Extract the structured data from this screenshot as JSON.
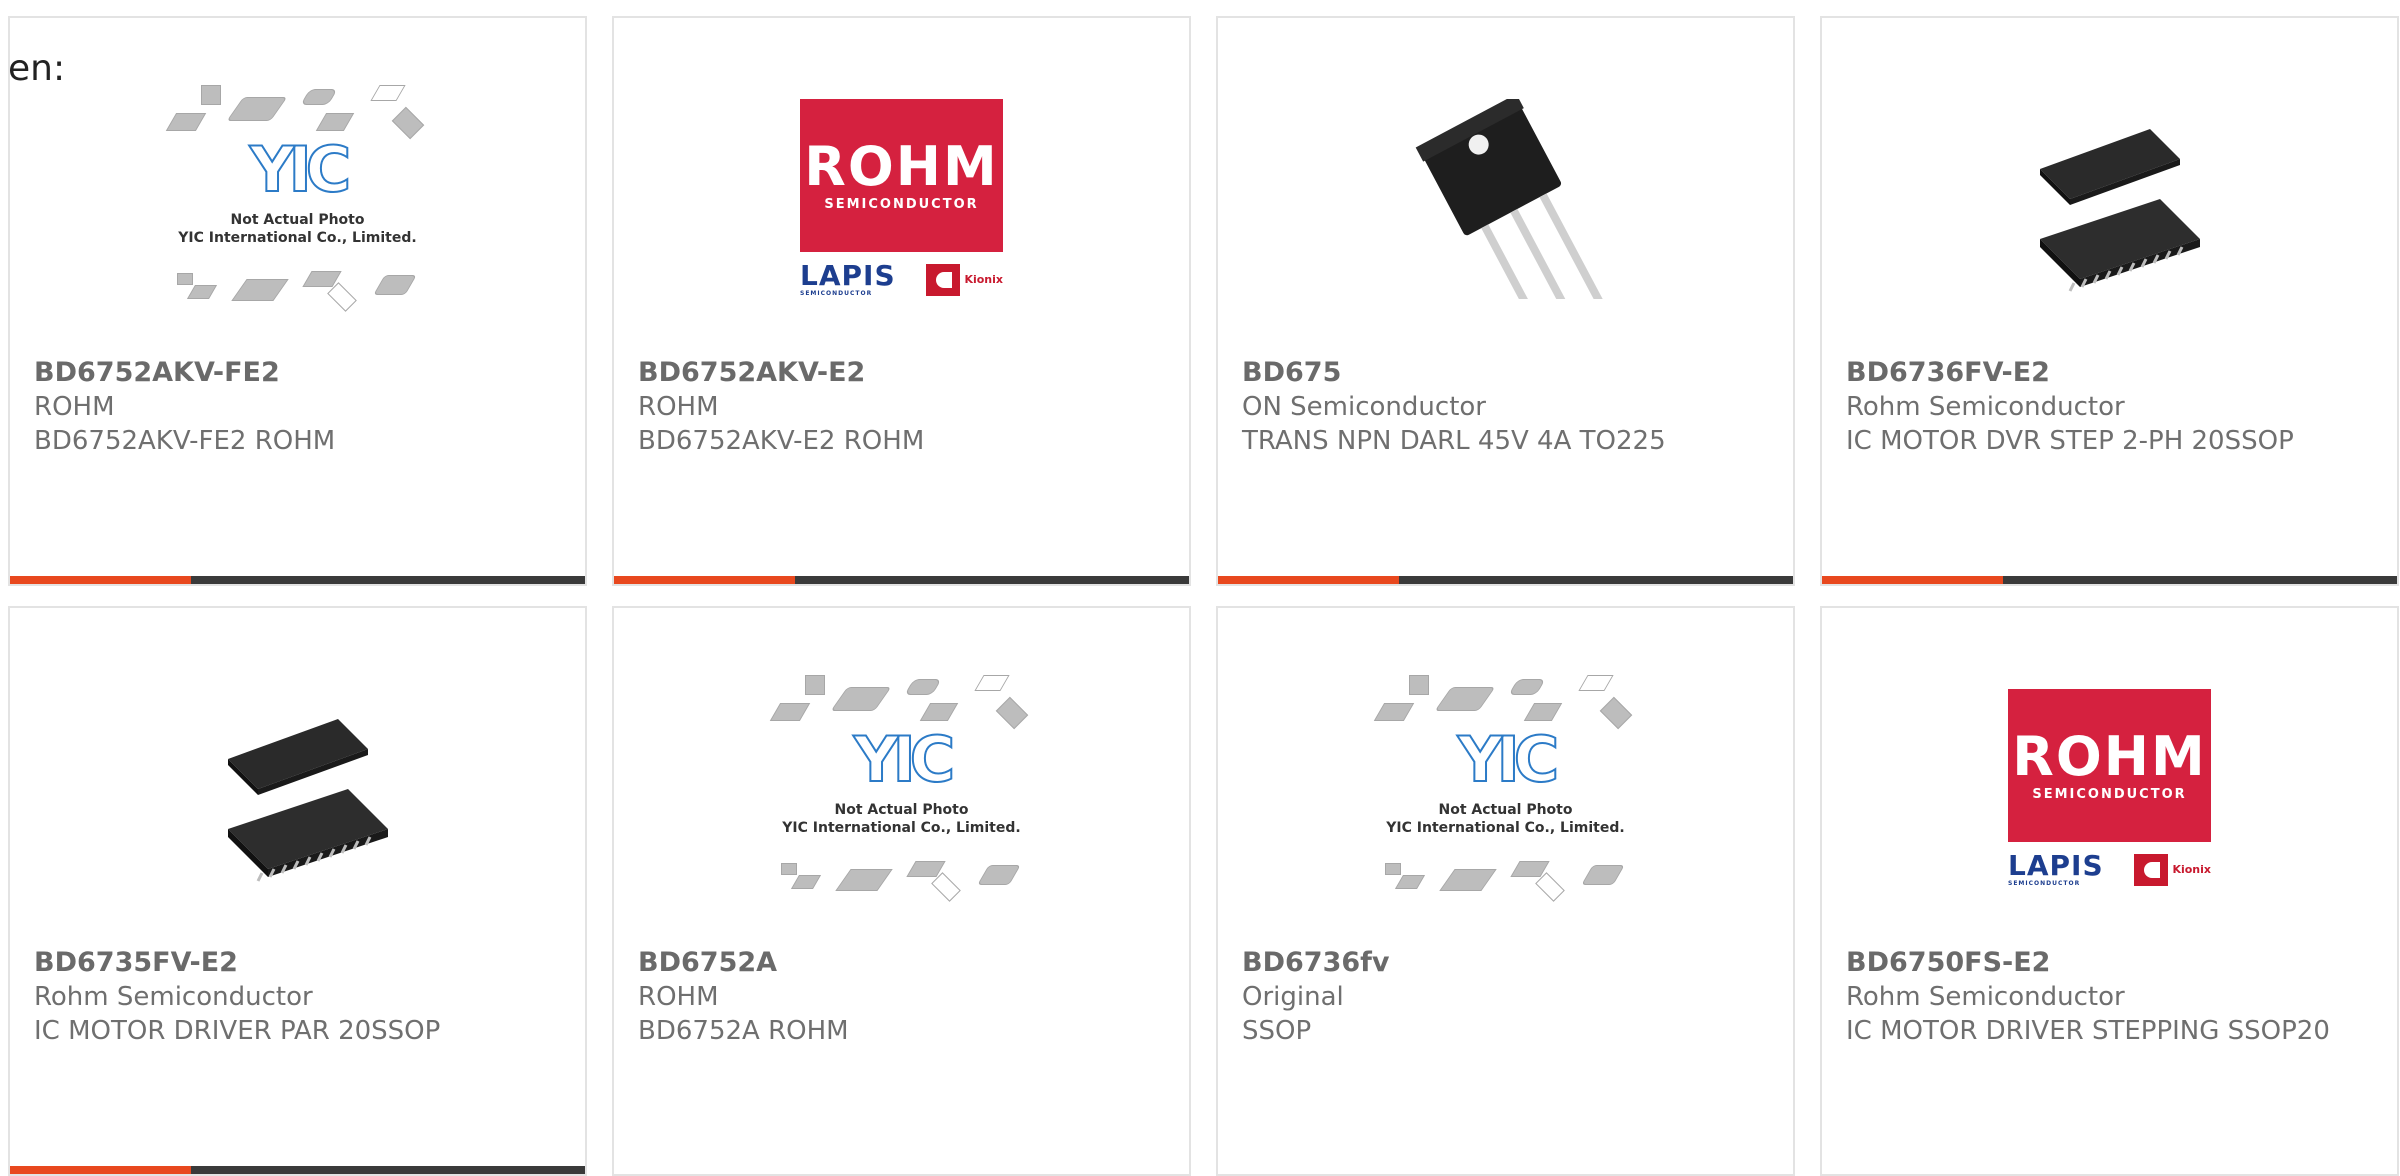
{
  "page": {
    "lang_label": "en:"
  },
  "products": [
    {
      "part_number": "BD6752AKV-FE2",
      "manufacturer": "ROHM",
      "description": "BD6752AKV-FE2 ROHM",
      "image": "yic-placeholder"
    },
    {
      "part_number": "BD6752AKV-E2",
      "manufacturer": "ROHM",
      "description": "BD6752AKV-E2 ROHM",
      "image": "rohm-logo"
    },
    {
      "part_number": "BD675",
      "manufacturer": "ON Semiconductor",
      "description": "TRANS NPN DARL 45V 4A TO225",
      "image": "to225-transistor"
    },
    {
      "part_number": "BD6736FV-E2",
      "manufacturer": "Rohm Semiconductor",
      "description": "IC MOTOR DVR STEP 2-PH 20SSOP",
      "image": "ssop-chip"
    },
    {
      "part_number": "BD6735FV-E2",
      "manufacturer": "Rohm Semiconductor",
      "description": "IC MOTOR DRIVER PAR 20SSOP",
      "image": "ssop-chip"
    },
    {
      "part_number": "BD6752A",
      "manufacturer": "ROHM",
      "description": "BD6752A ROHM",
      "image": "yic-placeholder"
    },
    {
      "part_number": "BD6736fv",
      "manufacturer": "Original",
      "description": "SSOP",
      "image": "yic-placeholder"
    },
    {
      "part_number": "BD6750FS-E2",
      "manufacturer": "Rohm Semiconductor",
      "description": "IC MOTOR DRIVER STEPPING SSOP20",
      "image": "rohm-logo"
    }
  ],
  "logos": {
    "rohm_text": "ROHM",
    "rohm_sub": "SEMICONDUCTOR",
    "lapis_text": "LAPIS",
    "lapis_sub": "SEMICONDUCTOR",
    "kionix_text": "Kionix",
    "yic_text": "YIC",
    "yic_note_line1": "Not Actual Photo",
    "yic_note_line2": "YIC International Co., Limited."
  },
  "colors": {
    "accent": "#e8481e",
    "bar": "#3a3a3a",
    "rohm_red": "#d5213f",
    "lapis_blue": "#1d3e8f",
    "yic_blue": "#2c7bc7"
  }
}
